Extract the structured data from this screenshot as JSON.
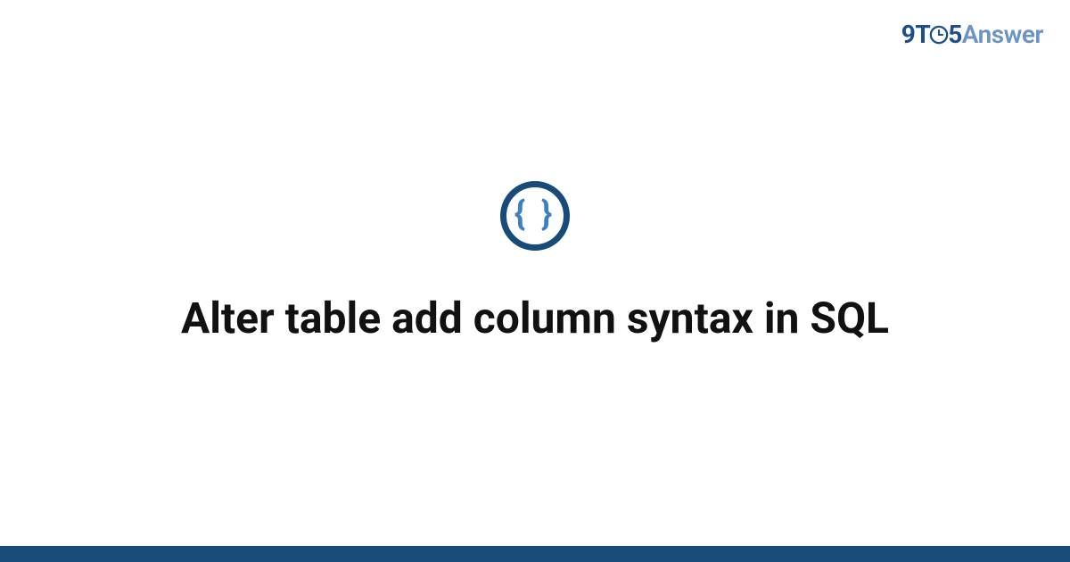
{
  "brand": {
    "nine": "9",
    "t": "T",
    "five": "5",
    "answer": "Answer"
  },
  "badge": {
    "glyph": "{ }"
  },
  "title": "Alter table add column syntax in SQL"
}
